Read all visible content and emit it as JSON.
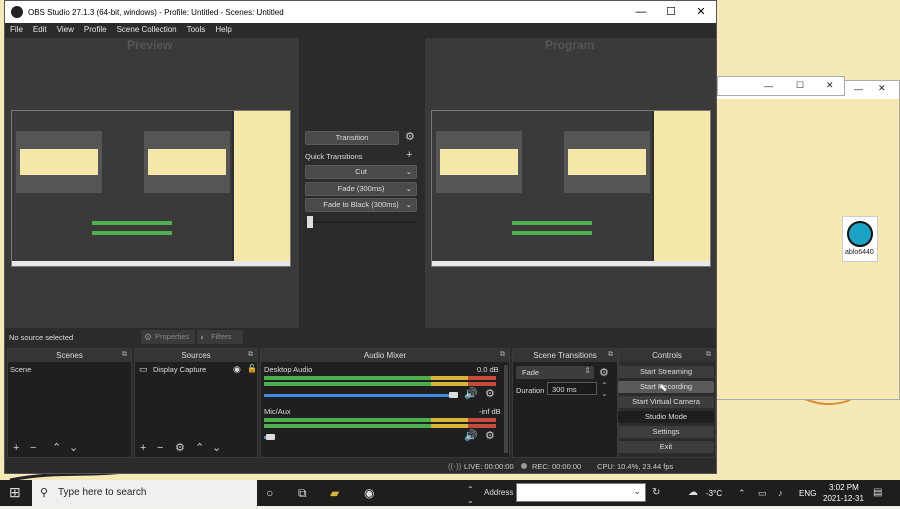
{
  "window": {
    "title": "OBS Studio 27.1.3 (64-bit, windows) - Profile: Untitled - Scenes: Untitled",
    "minimize": "—",
    "maximize": "☐",
    "close": "✕"
  },
  "menu": [
    "File",
    "Edit",
    "View",
    "Profile",
    "Scene Collection",
    "Tools",
    "Help"
  ],
  "preview_label": "Preview",
  "program_label": "Program",
  "transition": {
    "label": "Transition",
    "quick_transitions": "Quick Transitions",
    "items": [
      "Cut",
      "Fade (300ms)",
      "Fade to Black (300ms)"
    ]
  },
  "source_bar": {
    "no_source": "No source selected",
    "properties": "Properties",
    "filters": "Filters"
  },
  "docks": {
    "scenes": {
      "title": "Scenes",
      "items": [
        "Scene"
      ]
    },
    "sources": {
      "title": "Sources",
      "items": [
        "Display Capture"
      ]
    },
    "mixer": {
      "title": "Audio Mixer",
      "channels": [
        {
          "name": "Desktop Audio",
          "db": "0.0 dB",
          "level": 0.62
        },
        {
          "name": "Mic/Aux",
          "db": "-inf dB",
          "level": 0.02
        }
      ]
    },
    "scene_transitions": {
      "title": "Scene Transitions",
      "selected": "Fade",
      "duration_label": "Duration",
      "duration_value": "300 ms"
    },
    "controls": {
      "title": "Controls",
      "buttons": [
        "Start Streaming",
        "Start Recording",
        "Start Virtual Camera",
        "Studio Mode",
        "Settings",
        "Exit"
      ]
    }
  },
  "status": {
    "live": "LIVE: 00:00:00",
    "rec": "REC: 00:00:00",
    "cpu": "CPU: 10.4%, 23.44 fps"
  },
  "background": {
    "partial_name": "ablo6440"
  },
  "taskbar": {
    "search_placeholder": "Type here to search",
    "address_label": "Address",
    "temperature": "-3°C",
    "language": "ENG",
    "time": "3:02 PM",
    "date": "2021-12-31"
  }
}
